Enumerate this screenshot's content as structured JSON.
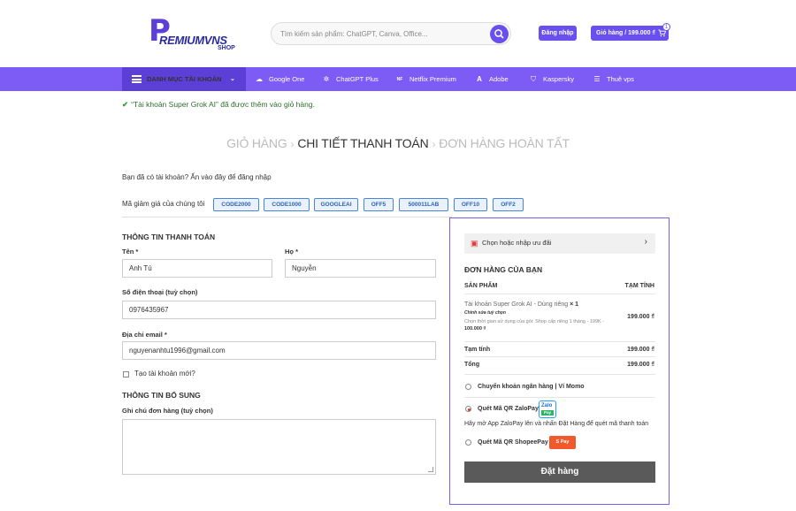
{
  "header": {
    "logo": {
      "letter": "P",
      "brand": "REMIUMVNS",
      "sub": "SHOP"
    },
    "search_placeholder": "Tìm kiếm sản phẩm: ChatGPT, Canva, Office...",
    "login_label": "Đăng nhập",
    "cart_label": "Giỏ hàng / 199.000 ₫",
    "cart_count": "1"
  },
  "nav": {
    "category_label": "DANH MỤC TÀI KHOẢN",
    "items": [
      {
        "label": "Google One",
        "icon": "cloud-icon"
      },
      {
        "label": "ChatGPT Plus",
        "icon": "openai-icon"
      },
      {
        "label": "Netflix Premium",
        "icon": "netflix-icon"
      },
      {
        "label": "Adobe",
        "icon": "adobe-icon"
      },
      {
        "label": "Kaspersky",
        "icon": "shield-icon"
      },
      {
        "label": "Thuê vps",
        "icon": "server-icon"
      }
    ]
  },
  "notice": "“Tài khoản Super Grok AI” đã được thêm vào giỏ hàng.",
  "steps": {
    "cart": "GIỎ HÀNG",
    "checkout": "CHI TIẾT THANH TOÁN",
    "done": "ĐƠN HÀNG HOÀN TẤT"
  },
  "login_prompt": "Bạn đã có tài khoản? Ấn vào đây để đăng nhập",
  "coupons": {
    "label": "Mã giảm giá của chúng tôi",
    "codes": [
      "CODE2000",
      "CODE1000",
      "GOOGLEAI",
      "OFF5",
      "500011LAB",
      "OFF10",
      "OFF2"
    ]
  },
  "billing": {
    "title": "THÔNG TIN THANH TOÁN",
    "first_name_label": "Tên *",
    "first_name": "Anh Tú",
    "last_name_label": "Họ *",
    "last_name": "Nguyễn",
    "phone_label": "Số điện thoại (tuỳ chọn)",
    "phone": "0976435967",
    "email_label": "Địa chỉ email *",
    "email": "nguyenanhtu1996@gmail.com",
    "create_account": "Tạo tài khoản mới?"
  },
  "additional": {
    "title": "THÔNG TIN BỔ SUNG",
    "notes_label": "Ghi chú đơn hàng (tuỳ chọn)"
  },
  "order": {
    "voucher": "Chọn hoặc nhập ưu đãi",
    "title": "ĐƠN HÀNG CỦA BẠN",
    "col_product": "SẢN PHẨM",
    "col_subtotal": "TẠM TÍNH",
    "product_name": "Tài khoản Super Grok AI - Dùng riêng",
    "product_qty": "× 1",
    "product_edit": "Chỉnh sửa tuỳ chọn",
    "product_option_label": "Chọn thời gian sử dụng của gói:",
    "product_option_value": "Shop cấp riêng 1 tháng - 199K",
    "product_option_price": "100.000 ₫",
    "product_price": "199.000 ₫",
    "subtotal_label": "Tạm tính",
    "subtotal": "199.000 ₫",
    "total_label": "Tổng",
    "total": "199.000 ₫",
    "payments": [
      {
        "label": "Chuyển khoản ngân hàng",
        "extra": " | Ví Momo",
        "selected": false
      },
      {
        "label": "Quét Mã QR ZaloPay",
        "extra": "",
        "selected": true
      },
      {
        "label": "Quét Mã QR ShopeePay",
        "extra": "",
        "selected": false
      }
    ],
    "zalo_desc": "Hãy mở App ZaloPay lên và nhấn Đặt Hàng để quét mã thanh toán",
    "zalo_logo": {
      "top": "Zalo",
      "bottom": "Pay"
    },
    "shopee_logo": "S Pay",
    "place_order": "Đặt hàng"
  },
  "colors": {
    "brand": "#7c5cf5",
    "brand_dark": "#5b3fd6",
    "success": "#2f6c2f",
    "button": "#5a5a5a"
  }
}
